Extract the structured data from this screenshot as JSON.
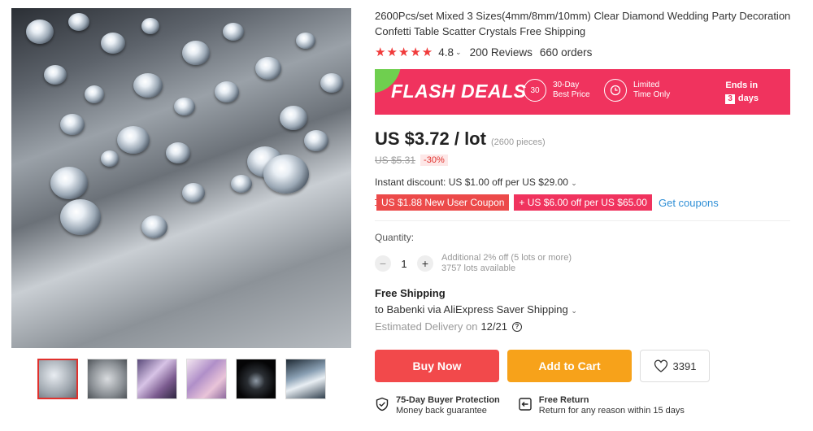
{
  "product": {
    "title": "2600Pcs/set Mixed 3 Sizes(4mm/8mm/10mm) Clear Diamond Wedding Party Decoration Confetti Table Scatter Crystals Free Shipping",
    "rating": "4.8",
    "reviews": "200 Reviews",
    "orders": "660 orders"
  },
  "flash": {
    "label": "FLASH DEALS",
    "best_price_icon": "30",
    "best_price_text": "30-Day Best Price",
    "limited_text": "Limited Time Only",
    "ends_label": "Ends in",
    "days_num": "3",
    "days_label": "days",
    "accent": "#f0335e"
  },
  "price": {
    "current": "US $3.72 / lot",
    "pieces": "(2600 pieces)",
    "original": "US $5.31",
    "discount": "-30%"
  },
  "discounts": {
    "instant": "Instant discount: US $1.00 off per US $29.00",
    "coupon_new_user": "US $1.88 New User Coupon",
    "coupon_store": "+ US $6.00 off per US $65.00",
    "get_coupons": "Get coupons"
  },
  "quantity": {
    "label": "Quantity:",
    "value": "1",
    "minus": "−",
    "plus": "+",
    "additional": "Additional 2% off (5 lots or more)",
    "available": "3757 lots available"
  },
  "shipping": {
    "title": "Free Shipping",
    "to": "to Babenki via AliExpress Saver Shipping",
    "estimated_label": "Estimated Delivery on",
    "estimated_date": "12/21"
  },
  "actions": {
    "buy_now": "Buy Now",
    "add_to_cart": "Add to Cart",
    "wishlist_count": "3391",
    "buy_color": "#f2494b",
    "cart_color": "#f7a21a"
  },
  "guarantees": {
    "protection_title": "75-Day Buyer Protection",
    "protection_sub": "Money back guarantee",
    "return_title": "Free Return",
    "return_sub": "Return for any reason within 15 days"
  },
  "icons": {
    "wishlist": "heart-icon",
    "protection": "shield-check-icon",
    "return": "return-arrow-icon",
    "help": "question-icon"
  }
}
